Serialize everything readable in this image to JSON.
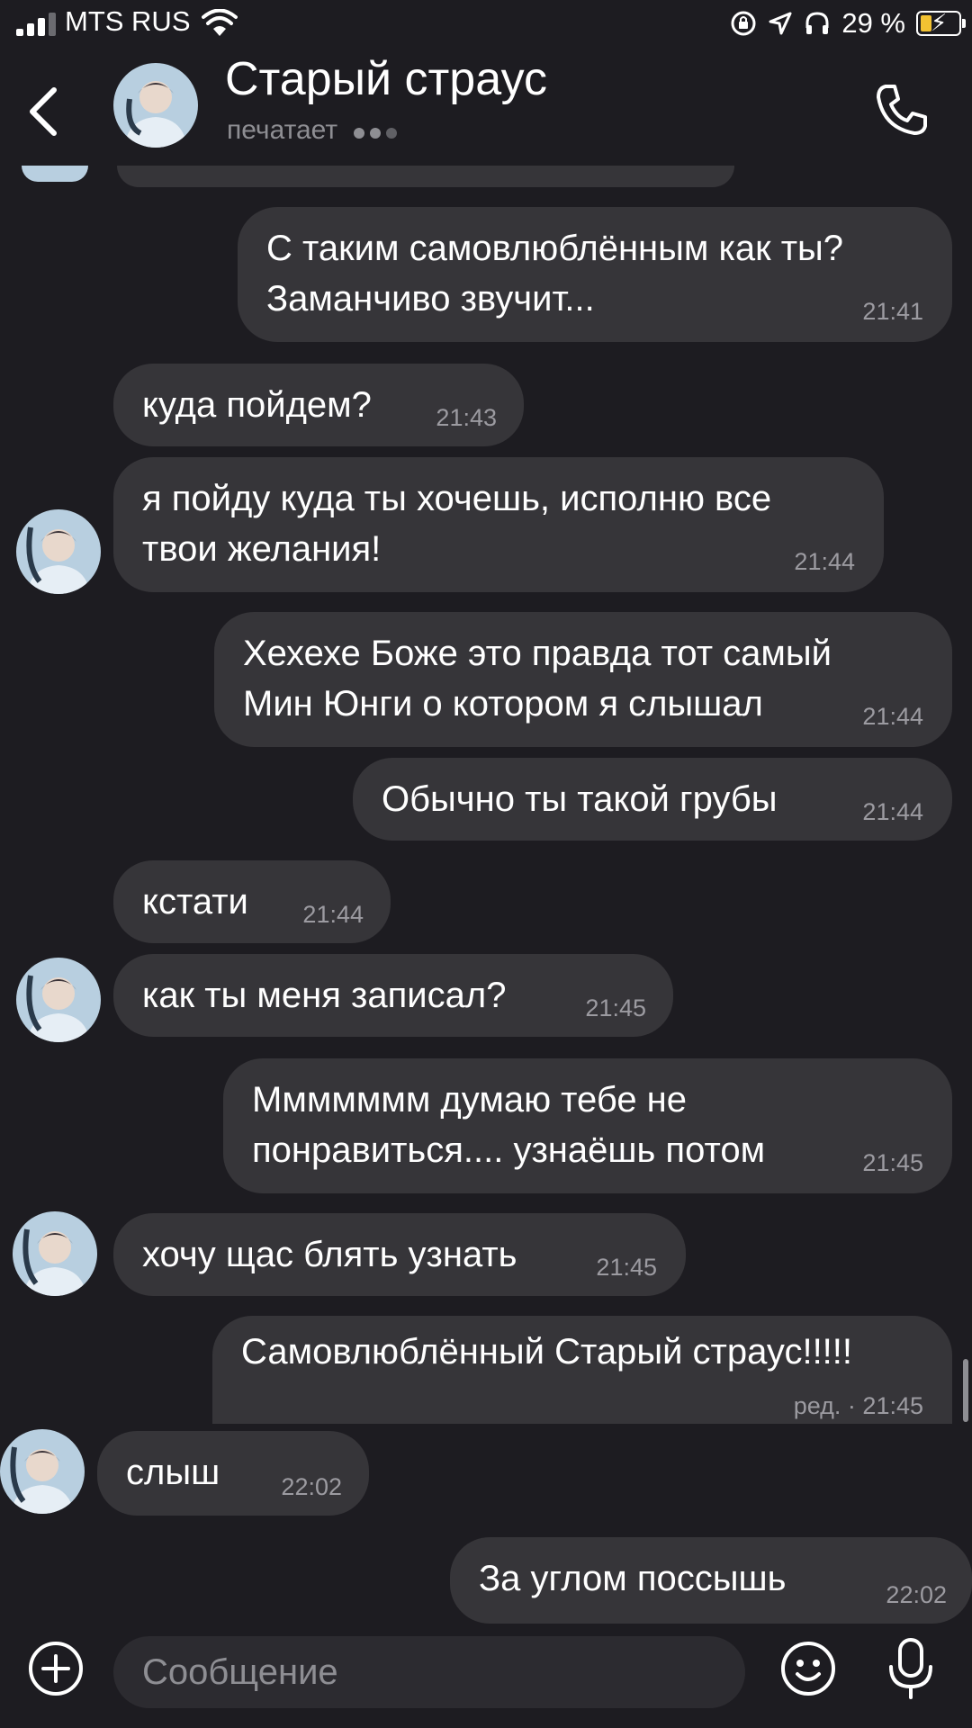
{
  "status_bar": {
    "carrier": "MTS RUS",
    "battery": "29 %"
  },
  "header": {
    "title": "Старый страус",
    "subtitle": "печатает",
    "icons": [
      "back-icon",
      "avatar",
      "phone-icon"
    ]
  },
  "messages": [
    {
      "side": "out",
      "text": "С таким самовлюблённым как ты?\nЗаманчиво звучит...",
      "time": "21:41"
    },
    {
      "side": "in",
      "text": "куда пойдем?",
      "time": "21:43"
    },
    {
      "side": "in",
      "text": "я пойду куда ты хочешь, исполню все\nтвои желания!",
      "time": "21:44"
    },
    {
      "side": "out",
      "text": "Хехехе Боже это правда тот самый\nМин Юнги о котором я слышал",
      "time": "21:44"
    },
    {
      "side": "out",
      "text": "Обычно ты такой грубы",
      "time": "21:44"
    },
    {
      "side": "in",
      "text": "кстати",
      "time": "21:44"
    },
    {
      "side": "in",
      "text": "как ты меня записал?",
      "time": "21:45"
    },
    {
      "side": "out",
      "text": "Ммммммм думаю тебе не\nпонравиться.... узнаёшь потом",
      "time": "21:45"
    },
    {
      "side": "in",
      "text": "хочу щас блять узнать",
      "time": "21:45"
    },
    {
      "side": "out",
      "text": "Самовлюблённый Старый страус!!!!!",
      "time": "ред. · 21:45"
    },
    {
      "side": "in",
      "text": "слыш",
      "time": "22:02"
    },
    {
      "side": "out",
      "text": "За углом поссышь",
      "time": "22:02"
    }
  ],
  "input": {
    "placeholder": "Сообщение"
  },
  "colors": {
    "background": "#1d1c21",
    "bubble": "#363539",
    "secondary_text": "#8e8e93"
  }
}
